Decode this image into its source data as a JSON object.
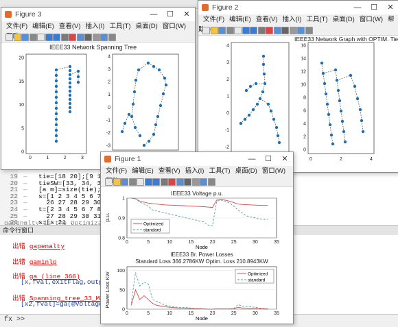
{
  "editor": {
    "lines": [
      {
        "no": "19",
        "code": "tie=[18 20];[9 15];[12 22];[18"
      },
      {
        "no": "20",
        "code": "tieSW=[33, 34, 35,36,37];"
      },
      {
        "no": "21",
        "code": "[a m]=size(tie);"
      },
      {
        "no": "22",
        "code": "s=[1 2 3 4 5 6 7 8 9  10 11 12"
      },
      {
        "no": "23",
        "code": "  26 27 28 29 30 31 32];"
      },
      {
        "no": "24",
        "code": "t=[2 3 4 5 6 7 8 9 10 11 12 13"
      },
      {
        "no": "25",
        "code": "  27 28 29 30 31 32 33];"
      },
      {
        "no": "26",
        "code": "s=[s 21 ..."
      }
    ],
    "partial": "gapenalty is the Optimization"
  },
  "command_window": {
    "header": "命令行窗口",
    "lines": [
      {
        "label": "出错",
        "text": "gapenalty"
      },
      {
        "label": "出错",
        "text": "gaminlp"
      },
      {
        "label": "出错",
        "text": "ga (line 366)"
      },
      {
        "label": "",
        "text": "[x,fval,exitFlag,output,population"
      },
      {
        "label": "出错",
        "text": "Spanning_tree_33_Main_2019 (l"
      },
      {
        "label": "",
        "text": "[x2,fval]=ga(@Voltage_fun_span_optim,"
      }
    ],
    "prompt": "fx >>"
  },
  "menu_items": [
    "文件(F)",
    "编辑(E)",
    "查看(V)",
    "插入(I)",
    "工具(T)",
    "桌面(D)",
    "窗口(W)",
    "帮助(H)"
  ],
  "figure3": {
    "title": "Figure 3",
    "plot_title": "IEEE33 Network Spanning Tree",
    "left_yticks": [
      "20",
      "15",
      "10",
      "5",
      "0"
    ],
    "left_xticks": [
      "0",
      "1",
      "2",
      "3"
    ],
    "right_yticks": [
      "4",
      "3",
      "2",
      "1",
      "0",
      "-1",
      "-2",
      "-3"
    ],
    "right_xticks": [
      "0",
      "2",
      "4"
    ]
  },
  "figure2": {
    "title": "Figure 2",
    "plot_title": "IEEE33 Network Graph with OPTIM. Tie SW",
    "left_yticks": [
      "4",
      "3",
      "2",
      "1",
      "0",
      "-1",
      "-2"
    ],
    "left_xticks": [
      "0",
      "5"
    ],
    "right_yticks": [
      "16",
      "14",
      "12",
      "10",
      "8",
      "6",
      "4",
      "2",
      "0"
    ],
    "right_xticks": [
      "0",
      "2",
      "4"
    ]
  },
  "figure1": {
    "title": "Figure 1",
    "top_plot": {
      "title": "IEEE33 Voltage p.u.",
      "ylabel": "p.u.",
      "yticks": [
        "1",
        "0.9",
        "0.8"
      ],
      "xticks": [
        "0",
        "5",
        "10",
        "15",
        "20",
        "25",
        "30",
        "35"
      ],
      "legend": [
        "Optimized",
        "standard"
      ]
    },
    "bottom_plot": {
      "title": "IEEE33 Br. Power Losses",
      "subtitle": "Standard Loss 366.2786KW  Optim. Loss 210.8943KW",
      "ylabel": "Power Loss KW",
      "xlabel": "Node",
      "yticks": [
        "100",
        "50",
        "0"
      ],
      "xticks": [
        "0",
        "5",
        "10",
        "15",
        "20",
        "25",
        "30",
        "35"
      ],
      "legend": [
        "Optimized",
        "standard"
      ]
    },
    "xlabel_top": "Node"
  },
  "chart_data": [
    {
      "type": "line",
      "title": "IEEE33 Voltage p.u.",
      "xlabel": "Node",
      "ylabel": "p.u.",
      "xlim": [
        0,
        35
      ],
      "ylim": [
        0.8,
        1.0
      ],
      "series": [
        {
          "name": "Optimized",
          "x": [
            1,
            2,
            3,
            4,
            5,
            6,
            7,
            8,
            9,
            10,
            11,
            12,
            13,
            14,
            15,
            16,
            17,
            18,
            19,
            20,
            21,
            22,
            23,
            24,
            25,
            26,
            27,
            28,
            29,
            30,
            31,
            32,
            33
          ],
          "values": [
            1.0,
            0.997,
            0.985,
            0.98,
            0.975,
            0.972,
            0.97,
            0.968,
            0.966,
            0.965,
            0.964,
            0.963,
            0.962,
            0.961,
            0.96,
            0.959,
            0.958,
            0.957,
            0.955,
            0.953,
            0.99,
            0.993,
            0.99,
            0.985,
            0.978,
            0.97,
            0.968,
            0.967,
            0.966,
            0.965,
            0.964,
            0.963,
            0.963
          ]
        },
        {
          "name": "standard",
          "x": [
            1,
            2,
            3,
            4,
            5,
            6,
            7,
            8,
            9,
            10,
            11,
            12,
            13,
            14,
            15,
            16,
            17,
            18,
            19,
            20,
            21,
            22,
            23,
            24,
            25,
            26,
            27,
            28,
            29,
            30,
            31,
            32,
            33
          ],
          "values": [
            1.0,
            0.997,
            0.98,
            0.97,
            0.96,
            0.94,
            0.935,
            0.93,
            0.925,
            0.92,
            0.915,
            0.91,
            0.905,
            0.9,
            0.895,
            0.89,
            0.885,
            0.88,
            0.865,
            0.86,
            0.985,
            0.99,
            0.985,
            0.975,
            0.96,
            0.94,
            0.925,
            0.91,
            0.905,
            0.9,
            0.895,
            0.893,
            0.893
          ]
        }
      ]
    },
    {
      "type": "line",
      "title": "IEEE33 Br. Power Losses",
      "xlabel": "Node",
      "ylabel": "Power Loss KW",
      "xlim": [
        0,
        35
      ],
      "ylim": [
        0,
        110
      ],
      "series": [
        {
          "name": "Optimized",
          "x": [
            1,
            2,
            3,
            4,
            5,
            6,
            7,
            8,
            9,
            10,
            11,
            12,
            13,
            14,
            15,
            16,
            17,
            18,
            19,
            20,
            21,
            22,
            23,
            24,
            25,
            26,
            27,
            28,
            29,
            30,
            31,
            32,
            33
          ],
          "values": [
            10,
            50,
            25,
            35,
            25,
            15,
            10,
            8,
            6,
            5,
            4,
            3,
            3,
            2,
            2,
            1,
            1,
            1,
            0,
            0,
            1,
            1,
            1,
            1,
            1,
            5,
            3,
            3,
            2,
            2,
            1,
            1,
            0
          ]
        },
        {
          "name": "standard",
          "x": [
            1,
            2,
            3,
            4,
            5,
            6,
            7,
            8,
            9,
            10,
            11,
            12,
            13,
            14,
            15,
            16,
            17,
            18,
            19,
            20,
            21,
            22,
            23,
            24,
            25,
            26,
            27,
            28,
            29,
            30,
            31,
            32,
            33
          ],
          "values": [
            15,
            95,
            60,
            70,
            65,
            25,
            20,
            15,
            10,
            8,
            6,
            5,
            4,
            4,
            3,
            2,
            2,
            1,
            0,
            0,
            1,
            1,
            1,
            1,
            2,
            12,
            8,
            7,
            6,
            5,
            3,
            2,
            1
          ]
        }
      ]
    }
  ],
  "colors": {
    "optimized": "#d94848",
    "standard": "#5a9ea0",
    "node": "#1f6fb4"
  }
}
